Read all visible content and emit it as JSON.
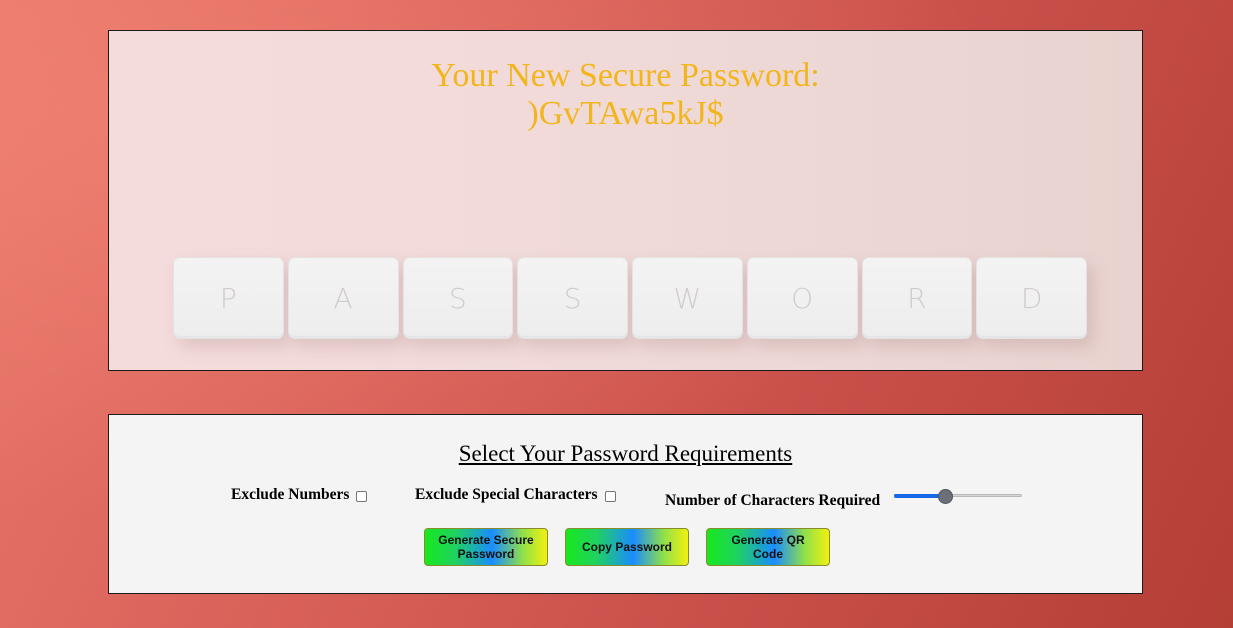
{
  "password_panel": {
    "heading": "Your New Secure Password:",
    "password": ")GvTAwa5kJ$",
    "heading_color": "#f3b51c",
    "image_keys": [
      "P",
      "A",
      "S",
      "S",
      "W",
      "O",
      "R",
      "D"
    ]
  },
  "requirements_panel": {
    "title": "Select Your Password Requirements",
    "exclude_numbers_label": "Exclude Numbers",
    "exclude_numbers_checked": false,
    "exclude_special_label": "Exclude Special Characters",
    "exclude_special_checked": false,
    "length_label": "Number of Characters Required",
    "length_slider_fraction": 0.4,
    "slider_accent": "#1768e6"
  },
  "buttons": {
    "generate_label": "Generate Secure Password",
    "copy_label": "Copy Password",
    "qr_label": "Generate QR Code"
  }
}
